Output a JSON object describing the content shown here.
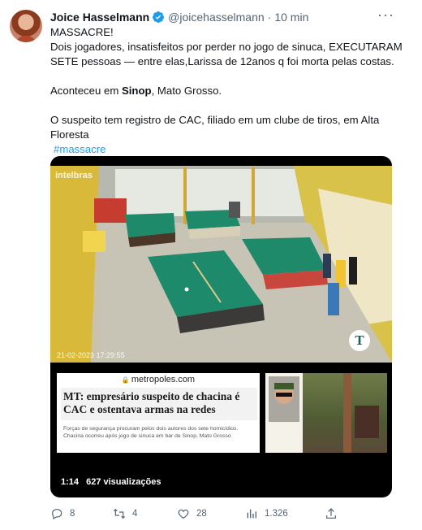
{
  "author": {
    "name": "Joice Hasselmann",
    "handle": "@joicehasselmann",
    "separator": "·",
    "time": "10 min"
  },
  "tweet": {
    "line1": "MASSACRE!",
    "line2": "Dois jogadores, insatisfeitos por perder no jogo de sinuca, EXECUTARAM SETE pessoas — entre elas,Larissa de 12anos q foi morta pelas costas.",
    "line3_pre": "Aconteceu em ",
    "line3_bold": "Sinop",
    "line3_post": ", Mato Grosso.",
    "line4": "O suspeito tem registro de CAC, filiado em um clube de tiros, em Alta Floresta",
    "hashtag": "#massacre"
  },
  "video": {
    "camera_logo": "intelbras",
    "timestamp": "21-02-2023 17:29:55",
    "badge": "T",
    "news_site": "metropoles.com",
    "news_title": "MT: empresário suspeito de chacina é CAC e ostentava armas na redes",
    "news_subtitle": "Forças de segurança procuram pelos dois autores dos sete homicídios. Chacina ocorreu após jogo de sinuca em bar de Sinop, Mato Grosso",
    "duration": "1:14",
    "views": "627 visualizações"
  },
  "actions": {
    "replies": "8",
    "retweets": "4",
    "likes": "28",
    "views": "1.326"
  },
  "icons": [
    "verified-badge-icon",
    "more-icon",
    "reply-icon",
    "retweet-icon",
    "like-icon",
    "views-icon",
    "share-icon",
    "lock-icon"
  ],
  "colors": {
    "verified": "#1d9bf0",
    "hashtag": "#1d9bf0",
    "muted": "#536471",
    "pool_table": "#1f8a6a"
  }
}
